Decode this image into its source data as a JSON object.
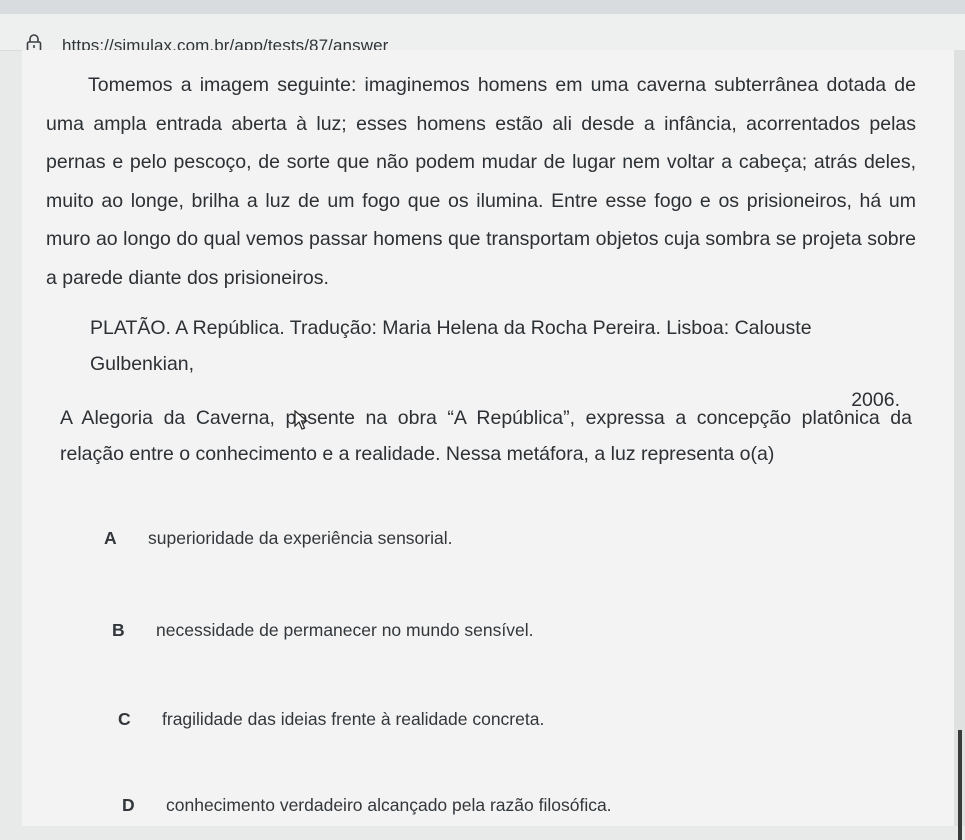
{
  "browser": {
    "url": "https://simulax.com.br/app/tests/87/answer",
    "lock_icon": "lock-icon"
  },
  "passage": {
    "text": "Tomemos a imagem seguinte: imaginemos homens em uma caverna subterrânea dotada de uma ampla entrada aberta à luz; esses homens estão ali desde a infância, acorrentados pelas pernas e pelo pescoço, de sorte que não podem mudar de lugar nem voltar a cabeça; atrás deles, muito ao longe, brilha a luz de um fogo que os ilumina. Entre esse fogo e os prisioneiros, há um muro ao longo do qual vemos passar homens que transportam objetos cuja sombra se projeta sobre a parede diante dos prisioneiros."
  },
  "citation": {
    "line1": "PLATÃO. A República. Tradução: Maria Helena da Rocha Pereira. Lisboa: Calouste Gulbenkian,",
    "line2": "2006."
  },
  "question": {
    "before_cursor": "A Alegoria da Caverna, p",
    "after_cursor": "esente na obra “A República”, expressa a concepção platônica da relação entre o conhecimento e a realidade. Nessa metáfora, a luz representa o(a)"
  },
  "options": [
    {
      "letter": "A",
      "text": "superioridade da experiência sensorial."
    },
    {
      "letter": "B",
      "text": "necessidade de permanecer no mundo sensível."
    },
    {
      "letter": "C",
      "text": "fragilidade das ideias frente à realidade concreta."
    },
    {
      "letter": "D",
      "text": "conhecimento verdadeiro alcançado pela razão filosófica."
    }
  ]
}
